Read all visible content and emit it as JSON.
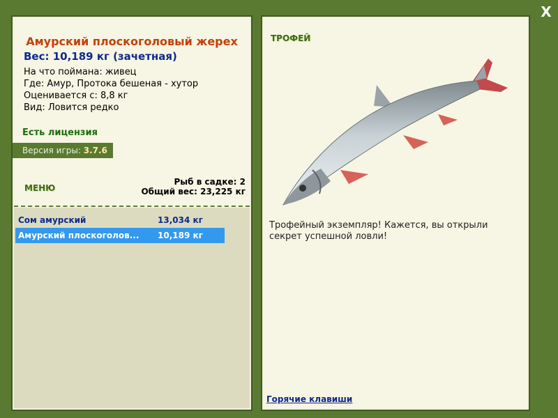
{
  "window": {
    "close_label": "X"
  },
  "fish": {
    "title": "Амурский плоскоголовый жерех",
    "weight": "Вес: 10,189 кг (зачетная)",
    "caught_on": "На что поймана: живец",
    "where": "Где: Амур, Протока бешеная - хутор",
    "valued_from": "Оценивается с: 8,8 кг",
    "kind": "Вид: Ловится редко"
  },
  "license": "Есть лицензия",
  "version": {
    "label": "Версия игры: ",
    "value": "3.7.6"
  },
  "menu_label": "МЕНЮ",
  "creel": {
    "count": "Рыб в садке: 2",
    "total": "Общий вес: 23,225 кг"
  },
  "fish_list": [
    {
      "name": "Сом амурский",
      "weight": "13,034 кг",
      "selected": false
    },
    {
      "name": "Амурский плоскоголов...",
      "weight": "10,189 кг",
      "selected": true
    }
  ],
  "trophy": {
    "label": "ТРОФЕЙ",
    "description": "Трофейный экземпляр! Кажется, вы открыли секрет успешной ловли!"
  },
  "hotkeys_label": "Горячие клавиши",
  "colors": {
    "background": "#5a7a32",
    "panel": "#f7f5e4",
    "title": "#c4400a",
    "weight": "#0d2a8c",
    "license": "#1c6e0c",
    "selected_row": "#3399ee"
  }
}
